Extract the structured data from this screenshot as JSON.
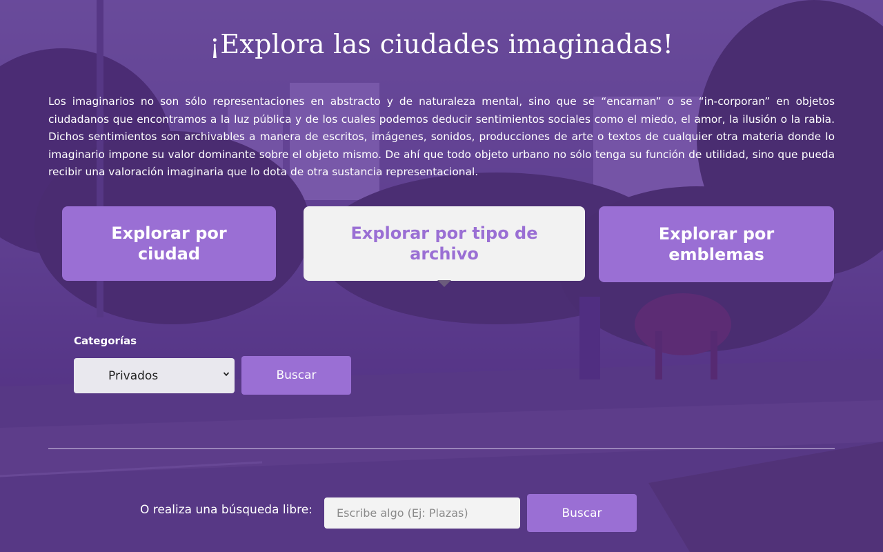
{
  "header": {
    "title": "¡Explora las ciudades imaginadas!"
  },
  "intro": {
    "text": "Los imaginarios no son sólo representaciones en abstracto y de naturaleza mental, sino que se “encarnan” o se “in-corporan” en objetos ciudadanos que encontramos a la luz pública y de los cuales podemos deducir sentimientos sociales como el miedo, el amor, la ilusión o la rabia. Dichos sentimientos son archivables a manera de escritos, imágenes, sonidos, producciones de arte o textos de cualquier otra materia donde lo imaginario impone su valor dominante sobre el objeto mismo. De ahí que todo objeto urbano no sólo tenga su función de utilidad, sino que pueda recibir una valoración imaginaria que lo dota de otra sustancia representacional."
  },
  "tabs": [
    {
      "label": "Explorar por ciudad",
      "active": false
    },
    {
      "label": "Explorar por tipo de archivo",
      "active": true
    },
    {
      "label": "Explorar por emblemas",
      "active": false
    }
  ],
  "category_search": {
    "label": "Categorías",
    "selected": "Privados",
    "button_label": "Buscar"
  },
  "free_search": {
    "label": "O realiza una búsqueda libre:",
    "placeholder": "Escribe algo (Ej: Plazas)",
    "value": "",
    "button_label": "Buscar"
  },
  "colors": {
    "overlay": "#542498",
    "accent": "#9a6fd4",
    "active_tab_bg": "#f2f2f2",
    "text": "#ffffff"
  },
  "icons": {
    "select_chevron": "chevron-down-icon"
  }
}
